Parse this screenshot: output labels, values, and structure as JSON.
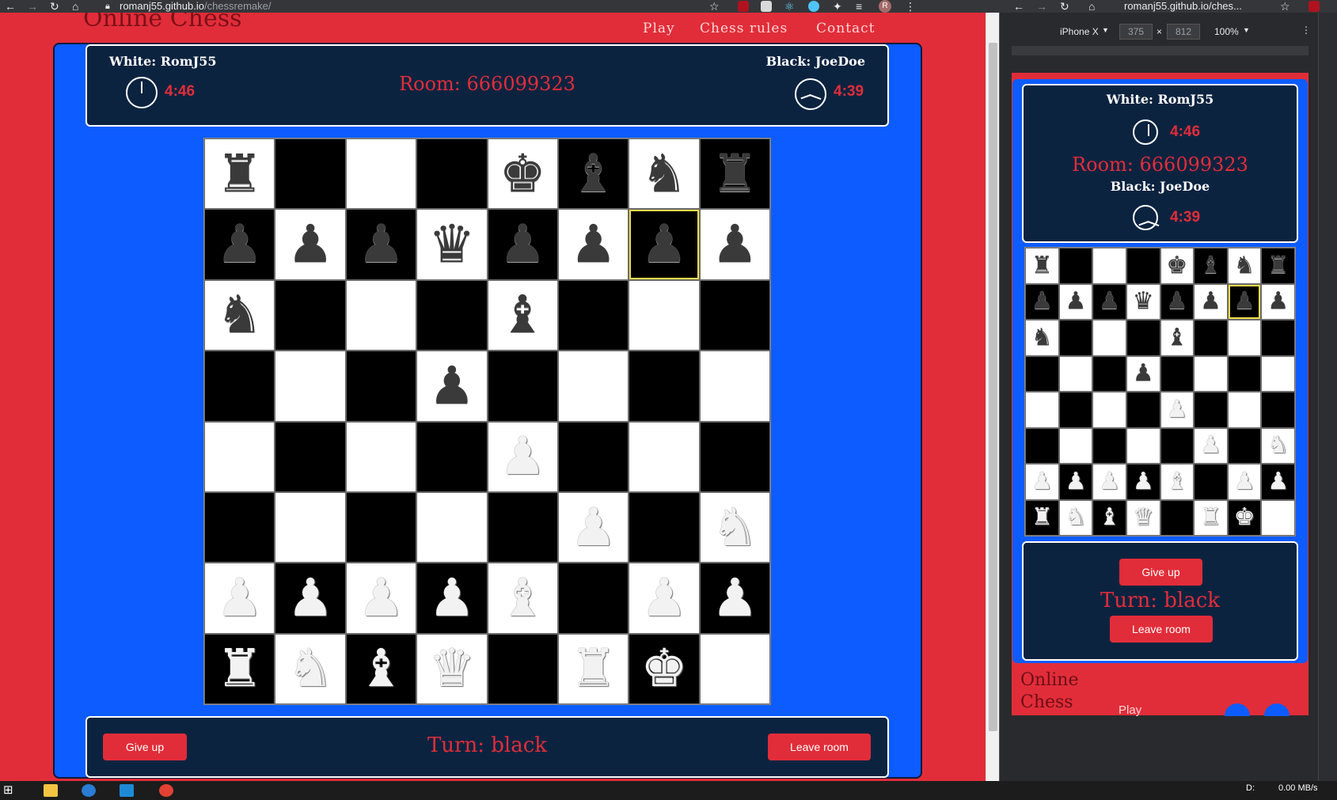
{
  "browser": {
    "left_url_host": "romanj55.github.io",
    "left_url_path": "/chessremake/",
    "right_url": "romanj55.github.io/ches...",
    "profile_initial": "R"
  },
  "site": {
    "title": "Online Chess",
    "nav": [
      "Play",
      "Chess rules",
      "Contact"
    ]
  },
  "game": {
    "white_label": "White: RomJ55",
    "black_label": "Black: JoeDoe",
    "white_time": "4:46",
    "black_time": "4:39",
    "room": "Room: 666099323",
    "turn": "Turn: black",
    "give_up": "Give up",
    "leave_room": "Leave room",
    "board": [
      [
        "br",
        "",
        "",
        "",
        "bk",
        "bb",
        "bn",
        "br"
      ],
      [
        "bp",
        "bp",
        "bp",
        "bq",
        "bp",
        "bp",
        "bp",
        "bp"
      ],
      [
        "bn",
        "",
        "",
        "",
        "bb",
        "",
        "",
        ""
      ],
      [
        "",
        "",
        "",
        "bp",
        "",
        "",
        "",
        ""
      ],
      [
        "",
        "",
        "",
        "",
        "wp",
        "",
        "",
        ""
      ],
      [
        "",
        "",
        "",
        "",
        "",
        "wp",
        "",
        "wn"
      ],
      [
        "wp",
        "wp",
        "wp",
        "wp",
        "wb",
        "",
        "wp",
        "wp"
      ],
      [
        "wr",
        "wn",
        "wb",
        "wq",
        "",
        "wr",
        "wk",
        ""
      ]
    ],
    "selected_square": [
      1,
      6
    ]
  },
  "devtools": {
    "device": "iPhone X",
    "width": "375",
    "height": "812",
    "zoom": "100%"
  },
  "mobile": {
    "footer_title": "Online Chess",
    "footer_play": "Play"
  },
  "taskbar": {
    "drive": "D:",
    "net": "0.00 MB/s"
  },
  "glyphs": {
    "k": "♚",
    "q": "♛",
    "r": "♜",
    "b": "♝",
    "n": "♞",
    "p": "♟"
  }
}
